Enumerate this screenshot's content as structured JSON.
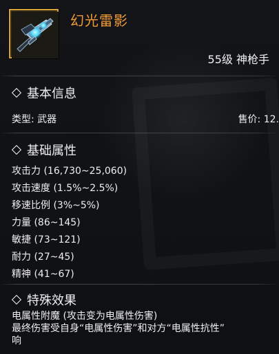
{
  "item": {
    "name": "幻光雷影",
    "level_class": "55级 神枪手"
  },
  "sections": {
    "basic_info": {
      "title": "基本信息",
      "type_label": "类型: 武器",
      "sale_price_label": "售价: 12."
    },
    "base_attributes": {
      "title": "基础属性",
      "lines": [
        "攻击力 (16,730~25,060)",
        "攻击速度 (1.5%~2.5%)",
        "移速比例 (3%~5%)",
        "力量 (86~145)",
        "敏捷 (73~121)",
        "耐力 (27~45)",
        "精神 (41~67)"
      ]
    },
    "special_effects": {
      "title": "特殊效果",
      "lines": [
        "电属性附魔 (攻击变为电属性伤害)",
        "最终伤害受自身“电属性伤害”和对方“电属性抗性”",
        "响"
      ]
    }
  },
  "colors": {
    "item_name": "#f29a36",
    "frame_border": "#d6a13d",
    "text": "#efefef",
    "background": "#0f1114"
  },
  "icons": {
    "item_icon": "gun-weapon-icon",
    "section_icon": "diamond-icon"
  }
}
